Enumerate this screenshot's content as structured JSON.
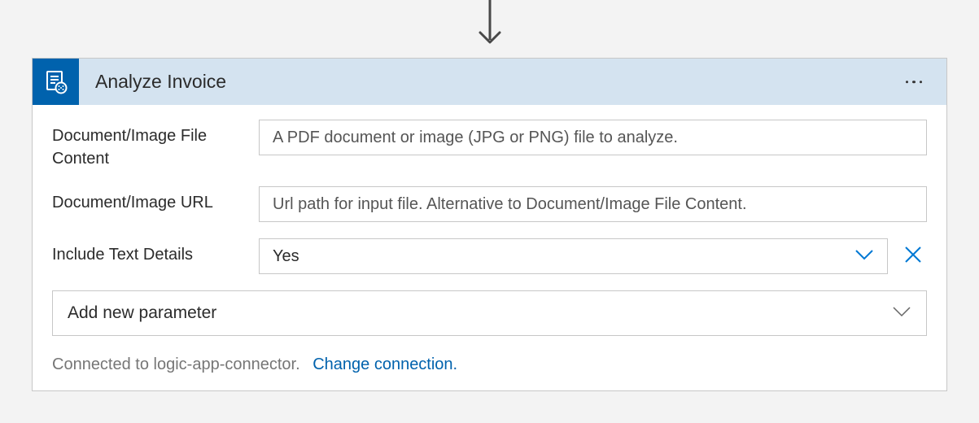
{
  "header": {
    "title": "Analyze Invoice"
  },
  "fields": {
    "fileContent": {
      "label": "Document/Image File Content",
      "placeholder": "A PDF document or image (JPG or PNG) file to analyze."
    },
    "url": {
      "label": "Document/Image URL",
      "placeholder": "Url path for input file. Alternative to Document/Image File Content."
    },
    "includeTextDetails": {
      "label": "Include Text Details",
      "value": "Yes"
    }
  },
  "addParameter": {
    "label": "Add new parameter"
  },
  "footer": {
    "connectedText": "Connected to logic-app-connector.",
    "changeLink": "Change connection."
  }
}
